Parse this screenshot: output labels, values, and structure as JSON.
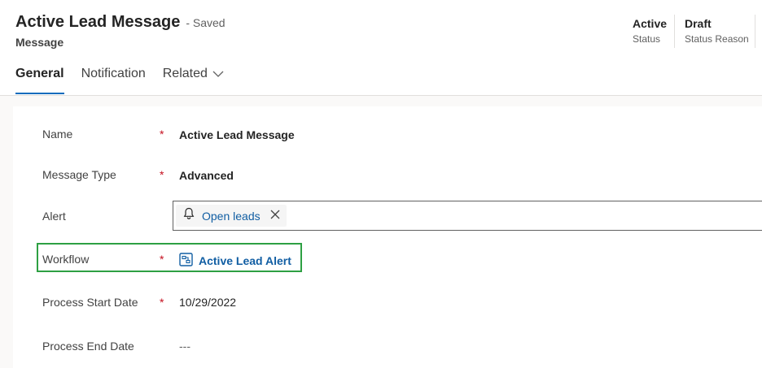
{
  "header": {
    "title": "Active Lead Message",
    "saved_status": "- Saved",
    "entity": "Message",
    "fields": [
      {
        "value": "Active",
        "label": "Status"
      },
      {
        "value": "Draft",
        "label": "Status Reason"
      }
    ]
  },
  "tabs": [
    {
      "label": "General",
      "active": true
    },
    {
      "label": "Notification",
      "active": false
    },
    {
      "label": "Related",
      "active": false
    }
  ],
  "form": {
    "name": {
      "label": "Name",
      "required": "*",
      "value": "Active Lead Message"
    },
    "message_type": {
      "label": "Message Type",
      "required": "*",
      "value": "Advanced"
    },
    "alert": {
      "label": "Alert",
      "value": "Open leads",
      "icon": "bell-icon"
    },
    "workflow": {
      "label": "Workflow",
      "required": "*",
      "value": "Active Lead Alert",
      "icon": "workflow-icon"
    },
    "process_start": {
      "label": "Process Start Date",
      "required": "*",
      "value": "10/29/2022"
    },
    "process_end": {
      "label": "Process End Date",
      "value": "---"
    }
  },
  "colors": {
    "accent": "#0f6cbd",
    "link": "#115ea3",
    "required": "#c50f1f",
    "highlight": "#2ea043"
  }
}
